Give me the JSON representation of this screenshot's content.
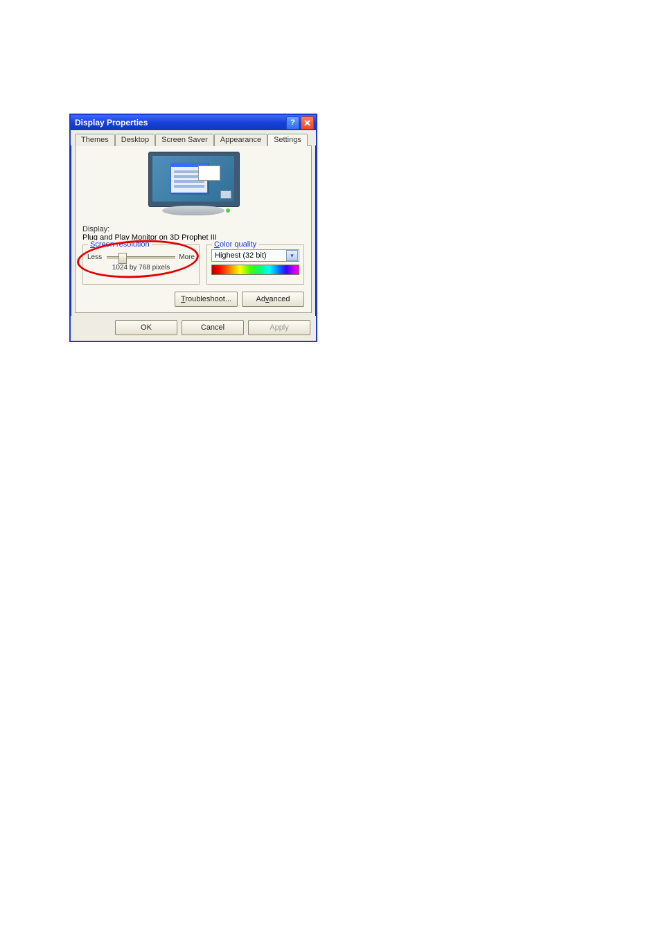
{
  "title": "Display Properties",
  "tabs": {
    "themes": "Themes",
    "desktop": "Desktop",
    "screensaver": "Screen Saver",
    "appearance": "Appearance",
    "settings": "Settings"
  },
  "display": {
    "label": "Display:",
    "value": "Plug and Play Monitor on 3D Prophet III"
  },
  "resolution": {
    "legend": "Screen resolution",
    "less": "Less",
    "more": "More",
    "value": "1024 by 768 pixels",
    "slider_percent": 22
  },
  "color_quality": {
    "legend": "Color quality",
    "selected": "Highest (32 bit)"
  },
  "buttons": {
    "troubleshoot": "Troubleshoot...",
    "advanced": "Advanced",
    "ok": "OK",
    "cancel": "Cancel",
    "apply": "Apply"
  }
}
